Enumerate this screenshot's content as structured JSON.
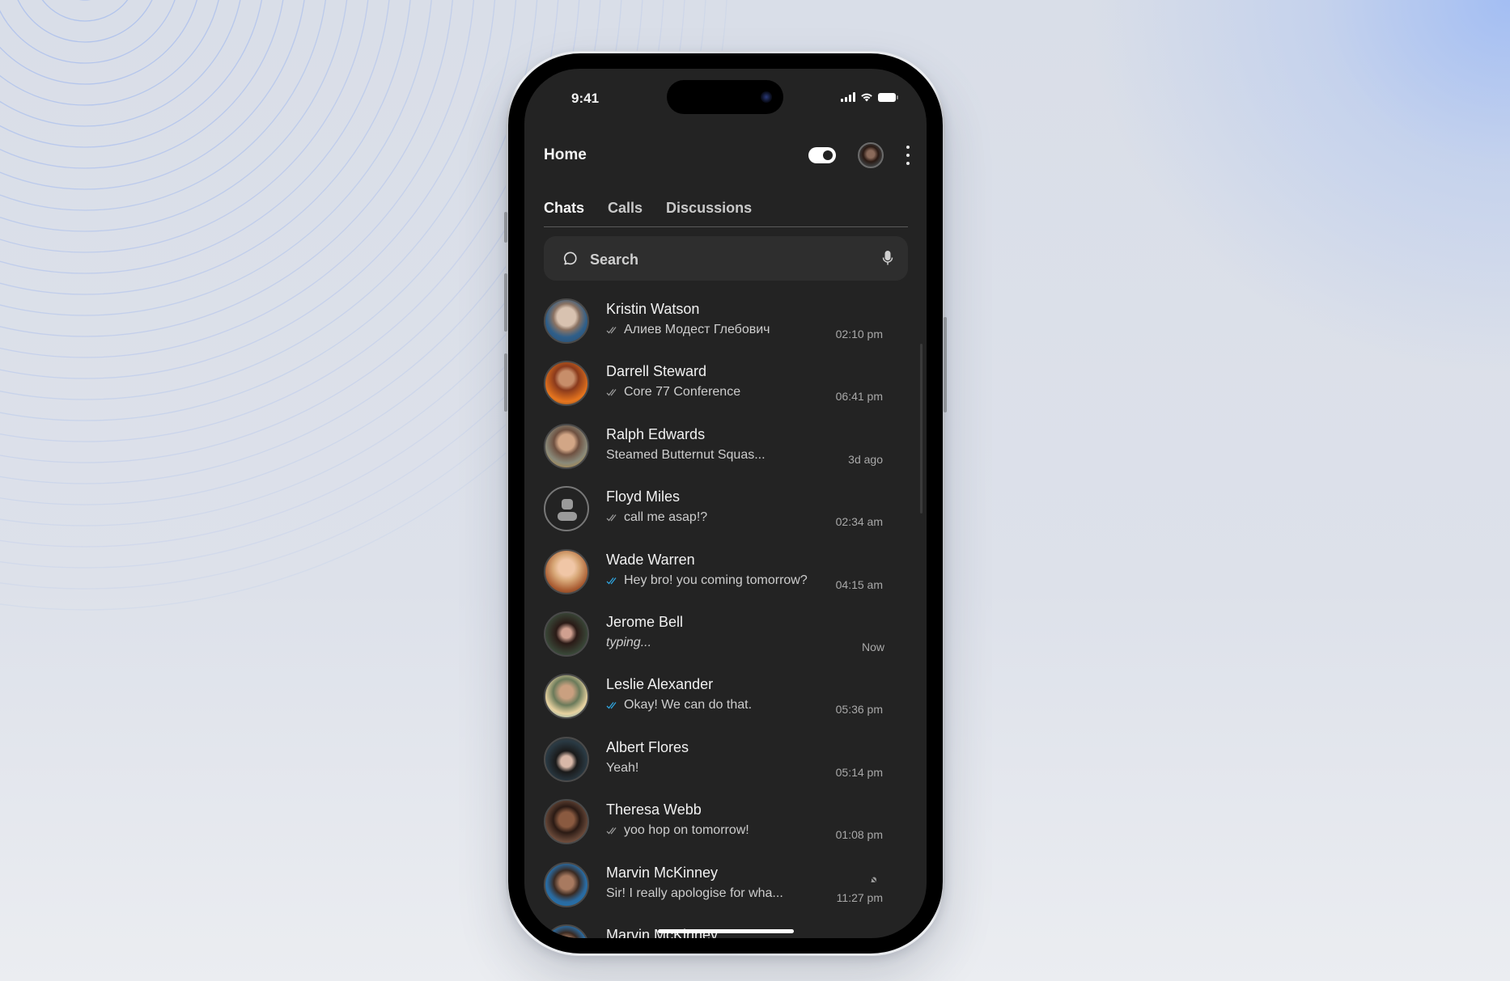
{
  "status_bar": {
    "time": "9:41",
    "icons": [
      "cellular-signal-icon",
      "wifi-icon",
      "battery-icon"
    ]
  },
  "header": {
    "title": "Home",
    "toggle": {
      "label": "theme-toggle",
      "on": true
    },
    "avatar": "profile-avatar",
    "menu_icon": "kebab-menu-icon"
  },
  "tabs": [
    {
      "label": "Chats",
      "active": true
    },
    {
      "label": "Calls",
      "active": false
    },
    {
      "label": "Discussions",
      "active": false
    }
  ],
  "search": {
    "placeholder": "Search",
    "value": "",
    "icon": "search-bubble-icon",
    "mic_icon": "microphone-icon"
  },
  "colors": {
    "screen_bg": "#232323",
    "search_bg": "#2e2e2e",
    "read_tick_blue": "#2fa3dc",
    "tick_gray": "#9a9a9a"
  },
  "chats": [
    {
      "name": "Kristin Watson",
      "message": "Алиев Модест Глебович",
      "time": "02:10 pm",
      "tick": "double-gray",
      "avatar": "photo"
    },
    {
      "name": "Darrell Steward",
      "message": "Core 77 Conference",
      "time": "06:41 pm",
      "tick": "double-gray",
      "avatar": "photo"
    },
    {
      "name": "Ralph Edwards",
      "message": "Steamed Butternut Squas...",
      "time": "3d ago",
      "tick": "none",
      "avatar": "photo"
    },
    {
      "name": "Floyd Miles",
      "message": "call me asap!?",
      "time": "02:34 am",
      "tick": "double-gray",
      "avatar": "default"
    },
    {
      "name": "Wade Warren",
      "message": "Hey bro! you coming tomorrow?",
      "time": "04:15 am",
      "tick": "double-blue",
      "avatar": "photo"
    },
    {
      "name": "Jerome Bell",
      "message": "typing...",
      "time": "Now",
      "tick": "none",
      "avatar": "photo",
      "typing": true
    },
    {
      "name": "Leslie Alexander",
      "message": "Okay! We can do that.",
      "time": "05:36 pm",
      "tick": "double-blue",
      "avatar": "photo"
    },
    {
      "name": "Albert Flores",
      "message": "Yeah!",
      "time": "05:14 pm",
      "tick": "none",
      "avatar": "photo"
    },
    {
      "name": "Theresa Webb",
      "message": "yoo hop on tomorrow!",
      "time": "01:08 pm",
      "tick": "double-gray",
      "avatar": "photo"
    },
    {
      "name": "Marvin McKinney",
      "message": "Sir! I really apologise for wha...",
      "time": "11:27 pm",
      "tick": "none",
      "avatar": "photo",
      "muted": true
    },
    {
      "name": "Marvin McKinney",
      "message": "",
      "time": "",
      "tick": "none",
      "avatar": "photo",
      "clipped": true
    }
  ]
}
